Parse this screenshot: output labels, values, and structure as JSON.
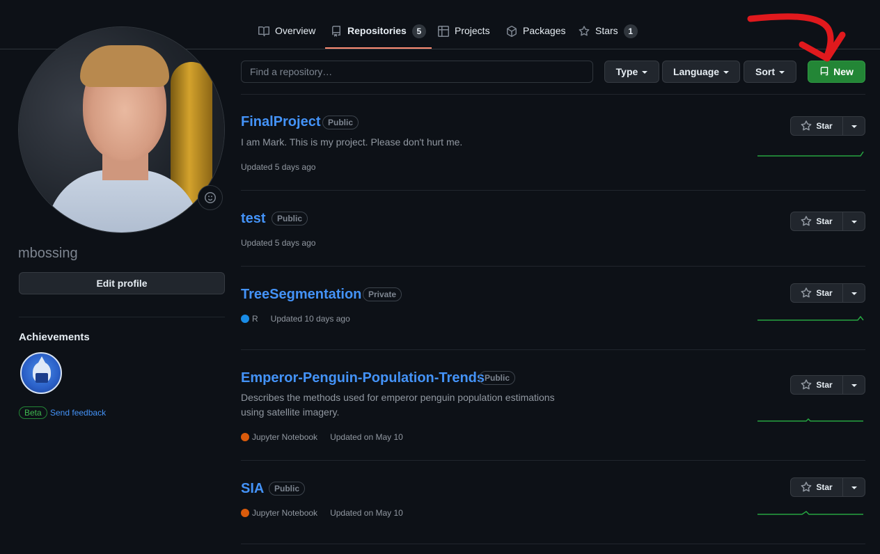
{
  "tabs": [
    {
      "label": "Overview",
      "icon": "book-icon"
    },
    {
      "label": "Repositories",
      "icon": "repo-icon",
      "count": "5"
    },
    {
      "label": "Projects",
      "icon": "table-icon"
    },
    {
      "label": "Packages",
      "icon": "package-icon"
    },
    {
      "label": "Stars",
      "icon": "star-icon",
      "count": "1"
    }
  ],
  "profile": {
    "username": "mbossing",
    "edit_label": "Edit profile",
    "achievements_title": "Achievements",
    "beta_label": "Beta",
    "feedback_label": "Send feedback"
  },
  "filters": {
    "search_placeholder": "Find a repository…",
    "type_label": "Type",
    "language_label": "Language",
    "sort_label": "Sort",
    "new_label": "New"
  },
  "repos": [
    {
      "name": "FinalProject",
      "visibility": "Public",
      "description": "I am Mark. This is my project. Please don't hurt me.",
      "description2": "",
      "language": "",
      "updated": "Updated 5 days ago",
      "star_label": "Star"
    },
    {
      "name": "test",
      "visibility": "Public",
      "description": "",
      "description2": "",
      "language": "",
      "updated": "Updated 5 days ago",
      "star_label": "Star"
    },
    {
      "name": "TreeSegmentation",
      "visibility": "Private",
      "description": "",
      "description2": "",
      "language": "R",
      "language_color": "#198ce7",
      "updated": "Updated 10 days ago",
      "star_label": "Star"
    },
    {
      "name": "Emperor-Penguin-Population-Trends",
      "visibility": "Public",
      "description": "Describes the methods used for emperor penguin population estimations",
      "description2": "using satellite imagery.",
      "language": "Jupyter Notebook",
      "language_color": "#DA5B0B",
      "updated": "Updated on May 10",
      "star_label": "Star"
    },
    {
      "name": "SIA",
      "visibility": "Public",
      "description": "",
      "description2": "",
      "language": "Jupyter Notebook",
      "language_color": "#DA5B0B",
      "updated": "Updated on May 10",
      "star_label": "Star"
    }
  ],
  "colors": {
    "background": "#0d1117",
    "link": "#4493f8",
    "new_button": "#238636",
    "annotation_arrow": "#e0191d"
  }
}
